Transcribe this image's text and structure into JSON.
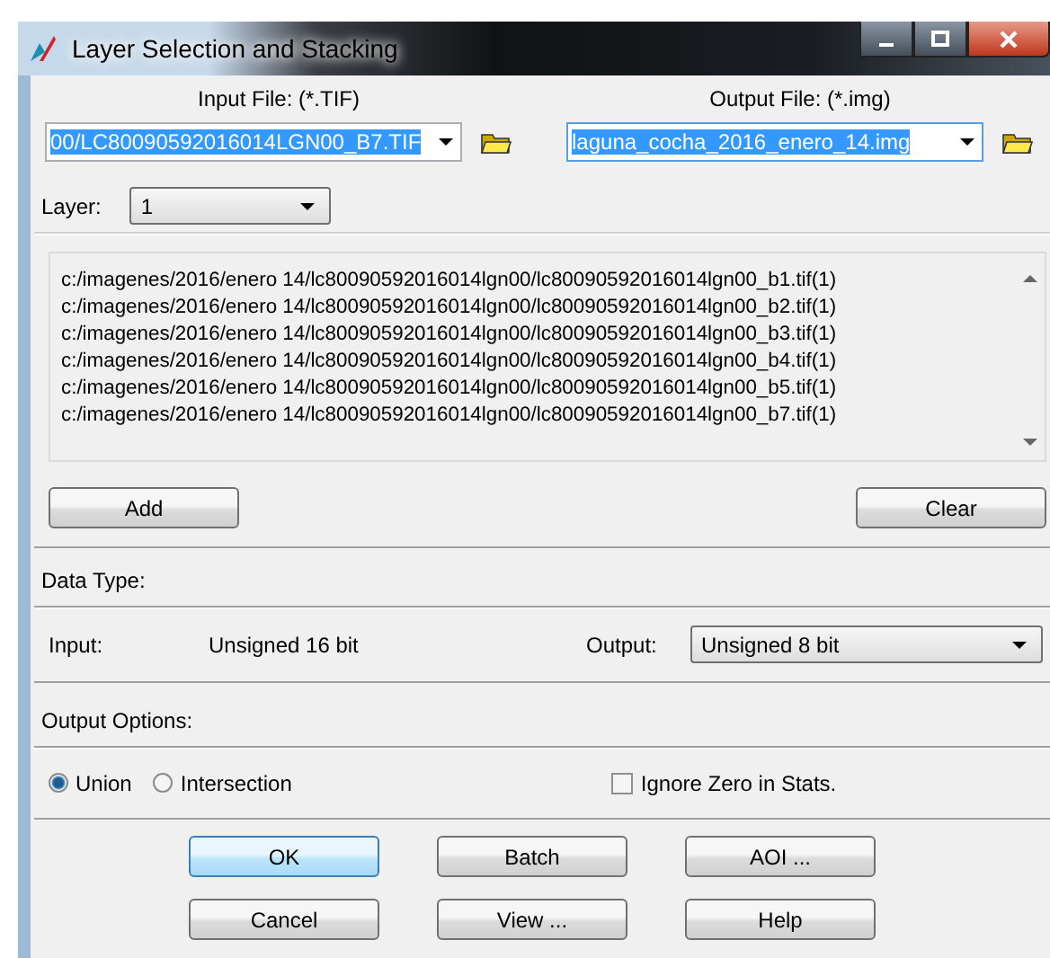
{
  "window": {
    "title": "Layer Selection and Stacking"
  },
  "input_file": {
    "label": "Input File: (*.TIF)",
    "value": "00/LC80090592016014LGN00_B7.TIF",
    "selected": true
  },
  "output_file": {
    "label": "Output File: (*.img)",
    "value": "laguna_cocha_2016_enero_14.img",
    "selected": true
  },
  "layer": {
    "label": "Layer:",
    "value": "1"
  },
  "layers_list": [
    "c:/imagenes/2016/enero 14/lc80090592016014lgn00/lc80090592016014lgn00_b1.tif(1)",
    "c:/imagenes/2016/enero 14/lc80090592016014lgn00/lc80090592016014lgn00_b2.tif(1)",
    "c:/imagenes/2016/enero 14/lc80090592016014lgn00/lc80090592016014lgn00_b3.tif(1)",
    "c:/imagenes/2016/enero 14/lc80090592016014lgn00/lc80090592016014lgn00_b4.tif(1)",
    "c:/imagenes/2016/enero 14/lc80090592016014lgn00/lc80090592016014lgn00_b5.tif(1)",
    "c:/imagenes/2016/enero 14/lc80090592016014lgn00/lc80090592016014lgn00_b7.tif(1)"
  ],
  "list_buttons": [
    "Add",
    "Clear"
  ],
  "data_type": {
    "label": "Data Type:",
    "input_label": "Input:",
    "input_value": "Unsigned 16 bit",
    "output_label": "Output:",
    "output_value": "Unsigned 8 bit"
  },
  "output_options": {
    "label": "Output Options:",
    "radios": [
      {
        "label": "Union",
        "selected": true
      },
      {
        "label": "Intersection",
        "selected": false
      }
    ],
    "ignore_zero": {
      "label": "Ignore Zero in Stats.",
      "checked": false
    }
  },
  "buttons": [
    {
      "label": "OK",
      "default": true
    },
    {
      "label": "Batch",
      "default": false
    },
    {
      "label": "AOI ...",
      "default": false
    },
    {
      "label": "Cancel",
      "default": false
    },
    {
      "label": "View ...",
      "default": false
    },
    {
      "label": "Help",
      "default": false
    }
  ]
}
